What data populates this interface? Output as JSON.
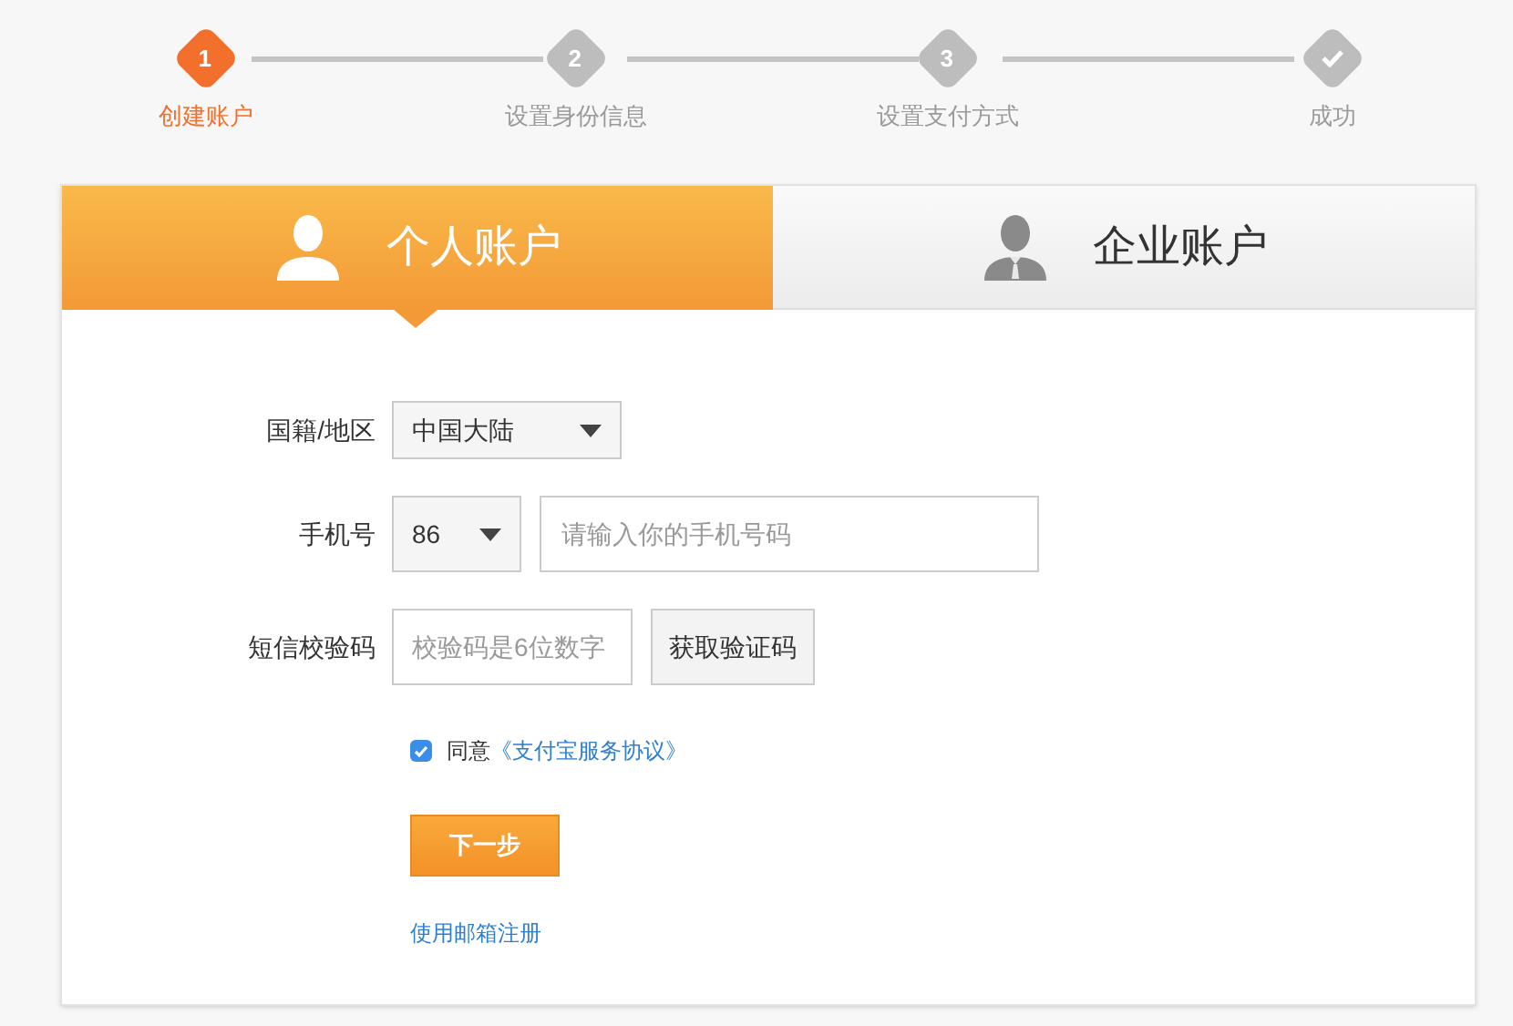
{
  "steps": [
    {
      "kind": "number",
      "marker": "1",
      "label": "创建账户",
      "selected": true
    },
    {
      "kind": "number",
      "marker": "2",
      "label": "设置身份信息",
      "selected": false
    },
    {
      "kind": "number",
      "marker": "3",
      "label": "设置支付方式",
      "selected": false
    },
    {
      "kind": "check",
      "label": "成功",
      "selected": false
    }
  ],
  "account_tabs": [
    {
      "kind": "person",
      "label": "个人账户",
      "selected": true
    },
    {
      "kind": "business",
      "label": "企业账户",
      "selected": false
    }
  ],
  "form": {
    "region": {
      "label": "国籍/地区",
      "value": "中国大陆"
    },
    "phone": {
      "label": "手机号",
      "code": "86",
      "placeholder": "请输入你的手机号码"
    },
    "sms": {
      "label": "短信校验码",
      "placeholder": "校验码是6位数字",
      "button": "获取验证码"
    },
    "agreement": {
      "checked": true,
      "text": "同意",
      "link": "《支付宝服务协议》"
    },
    "submit": "下一步",
    "email_link": "使用邮箱注册"
  }
}
